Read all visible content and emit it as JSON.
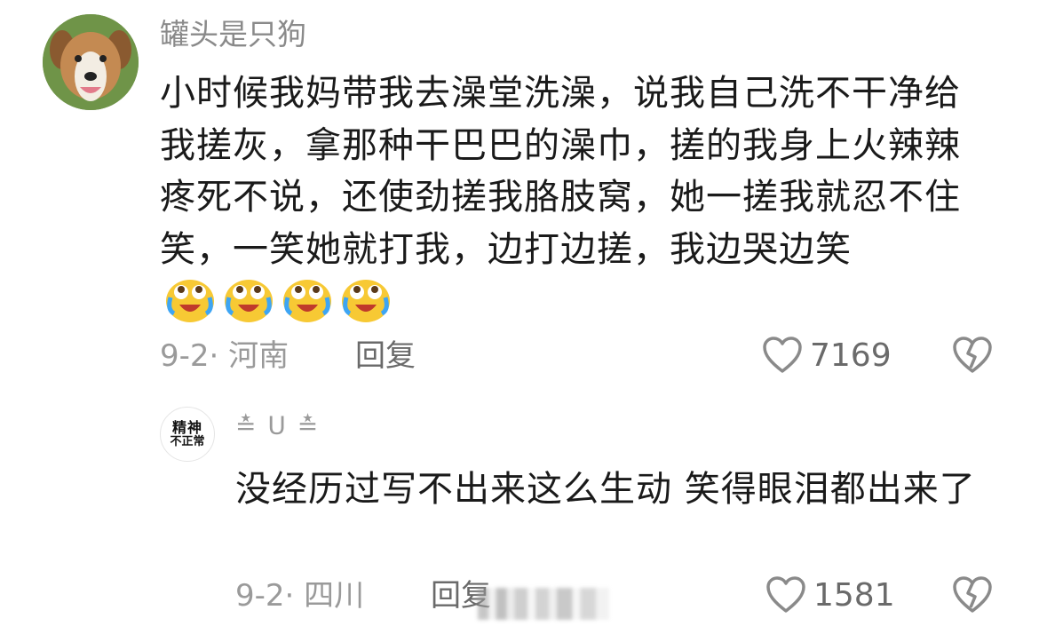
{
  "main_comment": {
    "username": "罐头是只狗",
    "text": "小时候我妈带我去澡堂洗澡，说我自己洗不干净给我搓灰，拿那种干巴巴的澡巾，搓的我身上火辣辣疼死不说，还使劲搓我胳肢窝，她一搓我就忍不住笑，一笑她就打我，边打边搓，我边哭边笑",
    "emojis": [
      "crying-laughing-emoji",
      "crying-laughing-emoji",
      "crying-laughing-emoji",
      "crying-laughing-emoji"
    ],
    "date_location": "9-2· 河南",
    "reply_label": "回复",
    "likes": "7169"
  },
  "reply_comment": {
    "avatar_text_line1": "精神",
    "avatar_text_line2": "不正常",
    "username": "≛ ᑌ ≛",
    "text": "没经历过写不出来这么生动 笑得眼泪都出来了",
    "date_location": "9-2· 四川",
    "reply_label": "回复",
    "likes": "1581"
  },
  "icons": {
    "like": "heart-outline-icon",
    "dislike": "broken-heart-icon"
  },
  "colors": {
    "meta_gray": "#9a9a9a",
    "text": "#1a1a1a",
    "username_gray": "#8a8a8a"
  }
}
